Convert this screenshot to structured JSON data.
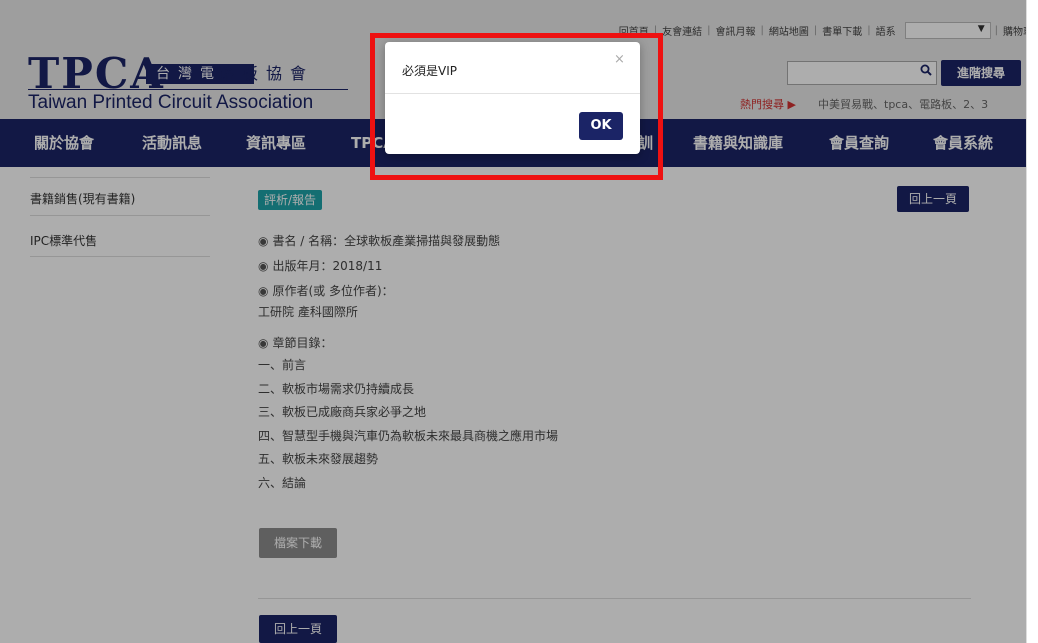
{
  "top_links": [
    "回首頁",
    "友會連結",
    "會訊月報",
    "網站地圖",
    "書單下載",
    "語系",
    "購物車"
  ],
  "language_select": {
    "value": "",
    "arrow": "▼"
  },
  "logo": {
    "abbr": "TPCA",
    "chinese_highlight": "台灣電",
    "chinese_rest": "路板協會",
    "english": "Taiwan Printed Circuit Association"
  },
  "search": {
    "placeholder": "",
    "button_label": "進階搜尋",
    "icon": "search-icon"
  },
  "hot_search": {
    "label": "熱門搜尋 ▶",
    "terms": "中美貿易戰、tpca、電路板、2、3"
  },
  "nav": [
    "關於協會",
    "活動訊息",
    "資訊專區",
    "TPCA",
    "訓",
    "書籍與知識庫",
    "會員查詢",
    "會員系統"
  ],
  "sidebar": {
    "items": [
      "書籍銷售(現有書籍)",
      "IPC標準代售"
    ]
  },
  "main": {
    "category": "評析/報告",
    "back_label": "回上一頁",
    "rows": [
      {
        "label": "書名 / 名稱：",
        "value": "全球軟板產業掃描與發展動態"
      },
      {
        "label": "出版年月：",
        "value": "2018/11"
      },
      {
        "label": "原作者(或 多位作者)：",
        "value": ""
      }
    ],
    "author": "工研院 產科國際所",
    "toc_label": "章節目錄：",
    "toc": [
      "一、前言",
      "二、軟板市場需求仍持續成長",
      "三、軟板已成廠商兵家必爭之地",
      "四、智慧型手機與汽車仍為軟板未來最具商機之應用市場",
      "五、軟板未來發展趨勢",
      "六、結論"
    ],
    "download_label": "檔案下載",
    "back_bottom_label": "回上一頁"
  },
  "modal": {
    "message": "必須是VIP",
    "close_glyph": "×",
    "ok_label": "OK"
  },
  "colors": {
    "brand_navy": "#1b2466",
    "badge_teal": "#1ea3a8",
    "highlight_red": "#ee1111",
    "hot_red": "#d23232"
  }
}
